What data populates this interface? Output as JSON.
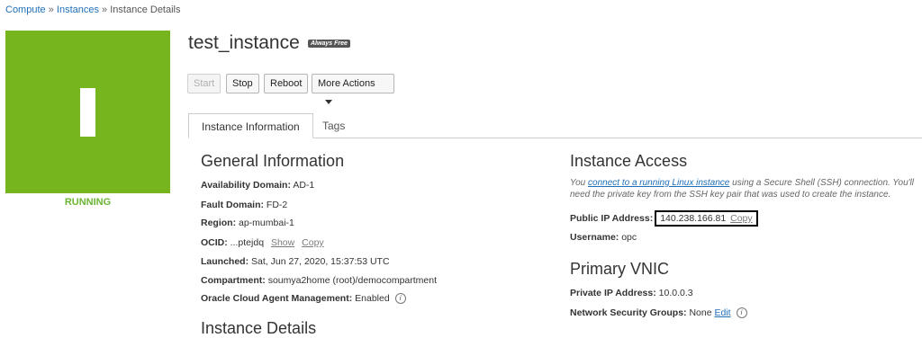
{
  "breadcrumb": {
    "item1": "Compute",
    "sep1": "»",
    "item2": "Instances",
    "sep2": "»",
    "item3": "Instance Details"
  },
  "tile": {
    "letter": "I",
    "state": "RUNNING",
    "color": "#77b51e"
  },
  "instance": {
    "name": "test_instance",
    "badge": "Always Free"
  },
  "actions": {
    "start": "Start",
    "stop": "Stop",
    "reboot": "Reboot",
    "more": "More Actions"
  },
  "tabs": {
    "info": "Instance Information",
    "tags": "Tags"
  },
  "general": {
    "heading": "General Information",
    "ad_label": "Availability Domain:",
    "ad_value": "AD-1",
    "fd_label": "Fault Domain:",
    "fd_value": "FD-2",
    "region_label": "Region:",
    "region_value": "ap-mumbai-1",
    "ocid_label": "OCID:",
    "ocid_value": "...ptejdq",
    "ocid_show": "Show",
    "ocid_copy": "Copy",
    "launched_label": "Launched:",
    "launched_value": "Sat, Jun 27, 2020, 15:37:53 UTC",
    "compartment_label": "Compartment:",
    "compartment_value": "soumya2home (root)/democompartment",
    "agent_label": "Oracle Cloud Agent Management:",
    "agent_value": "Enabled",
    "next_heading": "Instance Details"
  },
  "access": {
    "heading": "Instance Access",
    "desc_prefix": "You",
    "desc_link": "connect to a running Linux instance",
    "desc_suffix": "using a Secure Shell (SSH) connection. You'll need the private key from the SSH key pair that was used to create the instance.",
    "ip_label": "Public IP Address:",
    "ip_value": "140.238.166.81",
    "ip_copy": "Copy",
    "user_label": "Username:",
    "user_value": "opc"
  },
  "vnic": {
    "heading": "Primary VNIC",
    "private_ip_label": "Private IP Address:",
    "private_ip_value": "10.0.0.3",
    "nsg_label": "Network Security Groups:",
    "nsg_value": "None",
    "nsg_edit": "Edit"
  }
}
